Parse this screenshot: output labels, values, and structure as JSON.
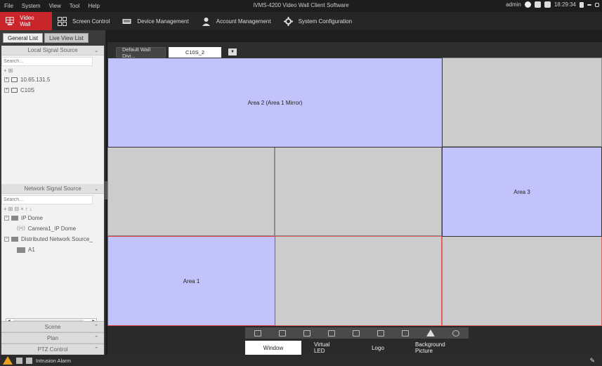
{
  "app": {
    "title": "iVMS-4200 Video Wall Client Software",
    "menu": [
      "File",
      "System",
      "View",
      "Tool",
      "Help"
    ],
    "user": "admin",
    "time": "18:29:34"
  },
  "modules": [
    {
      "label": "Video Wall",
      "icon": "video-wall-icon",
      "active": true
    },
    {
      "label": "Screen Control",
      "icon": "screen-control-icon"
    },
    {
      "label": "Device Management",
      "icon": "device-management-icon"
    },
    {
      "label": "Account Management",
      "icon": "account-icon"
    },
    {
      "label": "System Configuration",
      "icon": "gear-icon"
    }
  ],
  "left_panel": {
    "tabs": [
      "General List",
      "Live View List"
    ],
    "local_signal": {
      "title": "Local Signal Source",
      "search_placeholder": "Search...",
      "items": [
        "10.65.131.5",
        "C10S"
      ]
    },
    "network_signal": {
      "title": "Network Signal Source",
      "search_placeholder": "Search...",
      "items": [
        {
          "label": "IP Dome",
          "level": 0
        },
        {
          "label": "Camera1_IP Dome",
          "level": 1
        },
        {
          "label": "Distributed Network Source_",
          "level": 0
        },
        {
          "label": "A1",
          "level": 1
        }
      ]
    },
    "bottom_sections": [
      "Scene",
      "Plan",
      "PTZ Control"
    ]
  },
  "wall": {
    "tabs": [
      "Default Wall Divi...",
      "C10S_2"
    ],
    "areas": {
      "area2": "Area 2 (Area 1 Mirror)",
      "area3": "Area 3",
      "area1": "Area 1"
    },
    "bottom_tabs": [
      "Window",
      "Virtual LED",
      "Logo",
      "Background Picture"
    ]
  },
  "status": {
    "alarm_label": "Intrusion Alarm"
  },
  "colors": {
    "accent": "#c9262b",
    "area_fill": "#c3c3fb",
    "cell_fill": "#cccccc",
    "warning": "#e8a020"
  }
}
